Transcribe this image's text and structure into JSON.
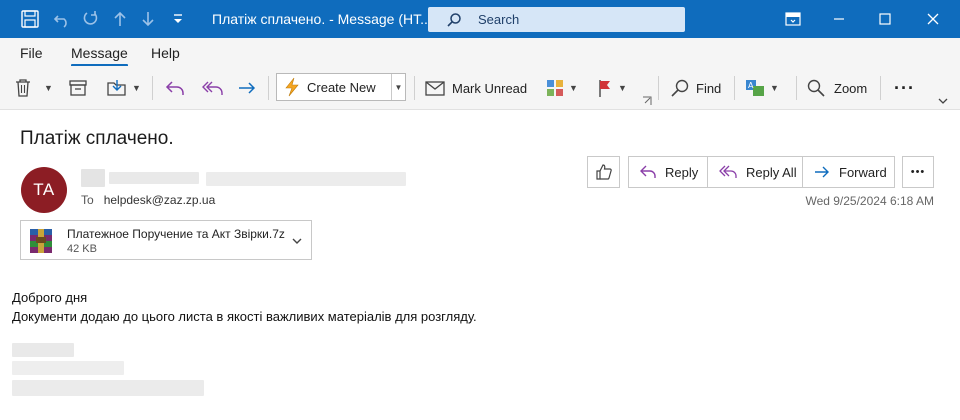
{
  "window": {
    "title": "Платіж сплачено.  -  Message (HT...",
    "search_label": "Search"
  },
  "menu": {
    "items": [
      {
        "label": "File"
      },
      {
        "label": "Message"
      },
      {
        "label": "Help"
      }
    ]
  },
  "ribbon": {
    "create_new": "Create New",
    "mark_unread": "Mark Unread",
    "find": "Find",
    "zoom": "Zoom",
    "more": "···"
  },
  "message": {
    "subject": "Платіж сплачено.",
    "avatar_initials": "TA",
    "to_label": "To",
    "to_address": "helpdesk@zaz.zp.ua",
    "date": "Wed 9/25/2024 6:18 AM",
    "actions": {
      "reply": "Reply",
      "reply_all": "Reply All",
      "forward": "Forward",
      "more": "•••"
    },
    "attachment": {
      "name": "Платежное Поручение та Акт Звірки.7z",
      "size": "42 KB"
    },
    "body": [
      "Доброго дня",
      "Документи додаю до цього листа в якості важливих матеріалів для розгляду."
    ]
  },
  "colors": {
    "titlebar": "#0f6cbd",
    "avatar": "#8c1d24",
    "accent": "#0f6cbd"
  }
}
